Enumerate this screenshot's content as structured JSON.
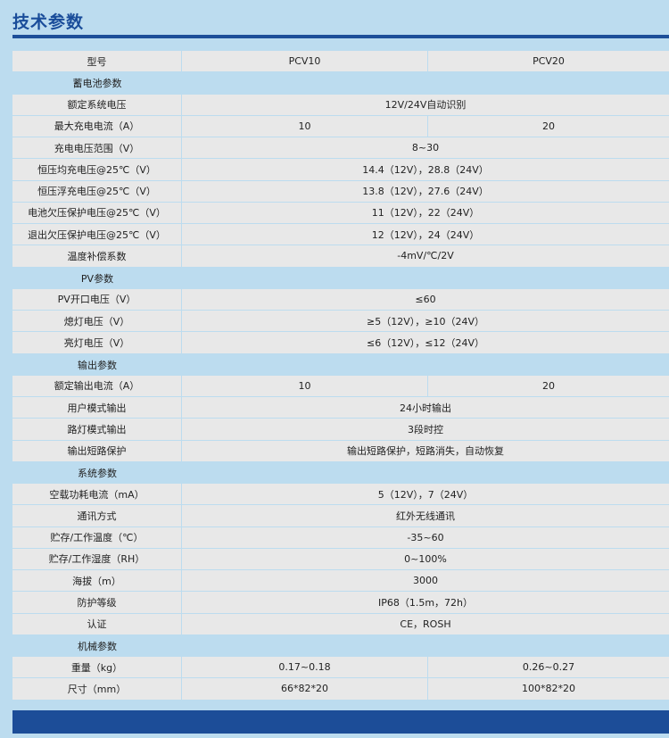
{
  "title": "技术参数",
  "header": {
    "label": "型号",
    "col_a": "PCV10",
    "col_b": "PCV20"
  },
  "sections": [
    {
      "heading": "蓄电池参数",
      "rows": [
        {
          "label": "额定系统电压",
          "span": "12V/24V自动识别"
        },
        {
          "label": "最大充电电流（A）",
          "a": "10",
          "b": "20"
        },
        {
          "label": "充电电压范围（V）",
          "span": "8~30"
        },
        {
          "label": "恒压均充电压@25℃（V）",
          "span": "14.4（12V），28.8（24V）"
        },
        {
          "label": "恒压浮充电压@25℃（V）",
          "span": "13.8（12V），27.6（24V）"
        },
        {
          "label": "电池欠压保护电压@25℃（V）",
          "span": "11（12V），22（24V）"
        },
        {
          "label": "退出欠压保护电压@25℃（V）",
          "span": "12（12V），24（24V）"
        },
        {
          "label": "温度补偿系数",
          "span": "-4mV/℃/2V"
        }
      ]
    },
    {
      "heading": "PV参数",
      "rows": [
        {
          "label": "PV开口电压（V）",
          "span": "≤60"
        },
        {
          "label": "熄灯电压（V）",
          "span": "≥5（12V），≥10（24V）"
        },
        {
          "label": "亮灯电压（V）",
          "span": "≤6（12V），≤12（24V）"
        }
      ]
    },
    {
      "heading": "输出参数",
      "rows": [
        {
          "label": "额定输出电流（A）",
          "a": "10",
          "b": "20"
        },
        {
          "label": "用户模式输出",
          "span": "24小时输出"
        },
        {
          "label": "路灯模式输出",
          "span": "3段时控"
        },
        {
          "label": "输出短路保护",
          "span": "输出短路保护，短路消失，自动恢复"
        }
      ]
    },
    {
      "heading": "系统参数",
      "rows": [
        {
          "label": "空载功耗电流（mA）",
          "span": "5（12V），7（24V）"
        },
        {
          "label": "通讯方式",
          "span": "红外无线通讯"
        },
        {
          "label": "贮存/工作温度（℃）",
          "span": "-35~60"
        },
        {
          "label": "贮存/工作湿度（RH）",
          "span": "0~100%"
        },
        {
          "label": "海拔（m）",
          "span": "3000"
        },
        {
          "label": "防护等级",
          "span": "IP68（1.5m，72h）"
        },
        {
          "label": "认证",
          "span": "CE，ROSH"
        }
      ]
    },
    {
      "heading": "机械参数",
      "rows": [
        {
          "label": "重量（kg）",
          "a": "0.17~0.18",
          "b": "0.26~0.27"
        },
        {
          "label": "尺寸（mm）",
          "a": "66*82*20",
          "b": "100*82*20"
        }
      ]
    }
  ]
}
